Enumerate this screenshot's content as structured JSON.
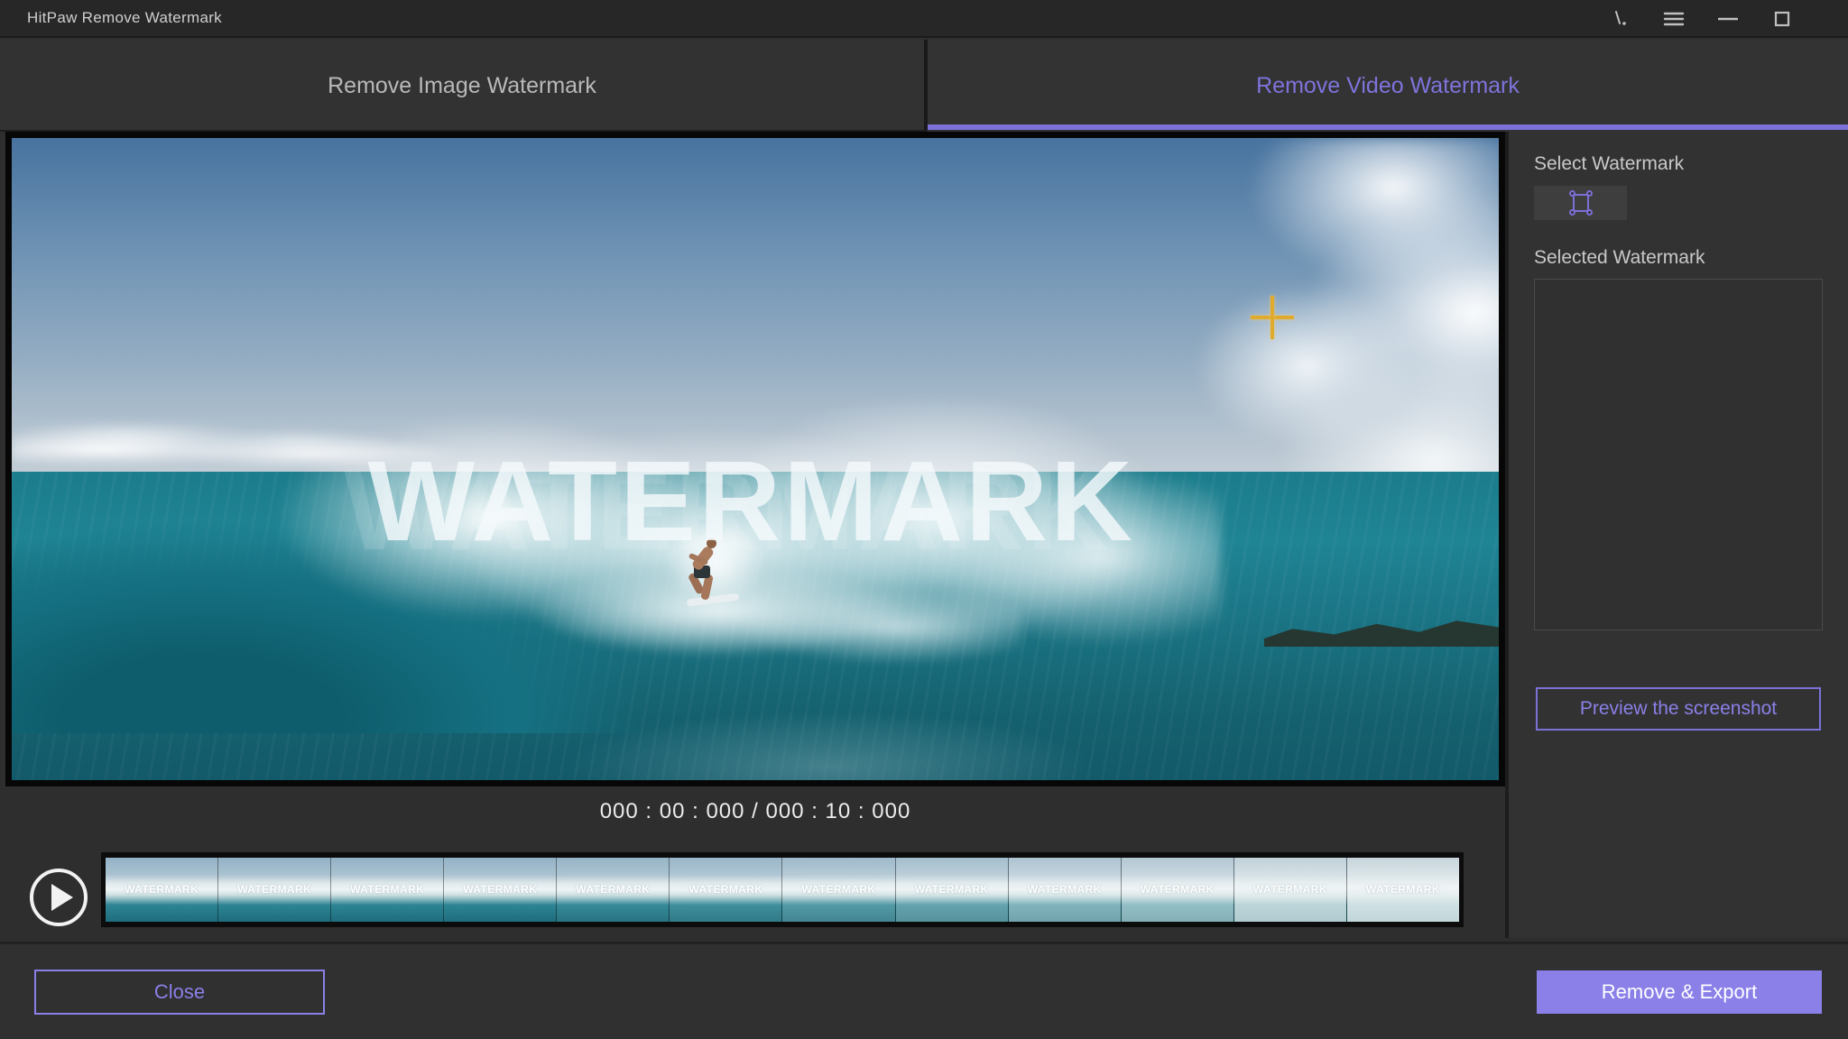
{
  "window": {
    "title": "HitPaw Remove Watermark",
    "controls": [
      {
        "icon": "feedback-icon"
      },
      {
        "icon": "menu-icon"
      },
      {
        "icon": "minimize-icon"
      },
      {
        "icon": "maximize-icon"
      }
    ]
  },
  "tabs": [
    {
      "label": "Remove Image Watermark",
      "active": false
    },
    {
      "label": "Remove Video Watermark",
      "active": true
    }
  ],
  "colors": {
    "accent_purple_fill": "#8a80e8",
    "accent_purple_text": "#7e74dc",
    "accent_underline": "#7b71d8",
    "crosshair_gold": "#dfaa2e"
  },
  "video": {
    "watermark_overlay_text": "WATERMARK",
    "timecode": "000 : 00 : 000 / 000 : 10 : 000",
    "play_icon": "play-icon",
    "crosshair_icon": "crosshair-cursor"
  },
  "panel": {
    "select_watermark_label": "Select Watermark",
    "selection_tool_icon": "marquee-selection-icon",
    "selected_watermark_label": "Selected Watermark",
    "preview_button_label": "Preview the screenshot"
  },
  "filmstrip": {
    "frames": [
      {
        "label": "WATERMARK",
        "foam": 0
      },
      {
        "label": "WATERMARK",
        "foam": 0
      },
      {
        "label": "WATERMARK",
        "foam": 0
      },
      {
        "label": "WATERMARK",
        "foam": 0
      },
      {
        "label": "WATERMARK",
        "foam": 0.05
      },
      {
        "label": "WATERMARK",
        "foam": 0.1
      },
      {
        "label": "WATERMARK",
        "foam": 0.2
      },
      {
        "label": "WATERMARK",
        "foam": 0.3
      },
      {
        "label": "WATERMARK",
        "foam": 0.45
      },
      {
        "label": "WATERMARK",
        "foam": 0.55
      },
      {
        "label": "WATERMARK",
        "foam": 0.78
      },
      {
        "label": "WATERMARK",
        "foam": 0.88
      }
    ]
  },
  "footer": {
    "close_label": "Close",
    "export_label": "Remove & Export"
  }
}
